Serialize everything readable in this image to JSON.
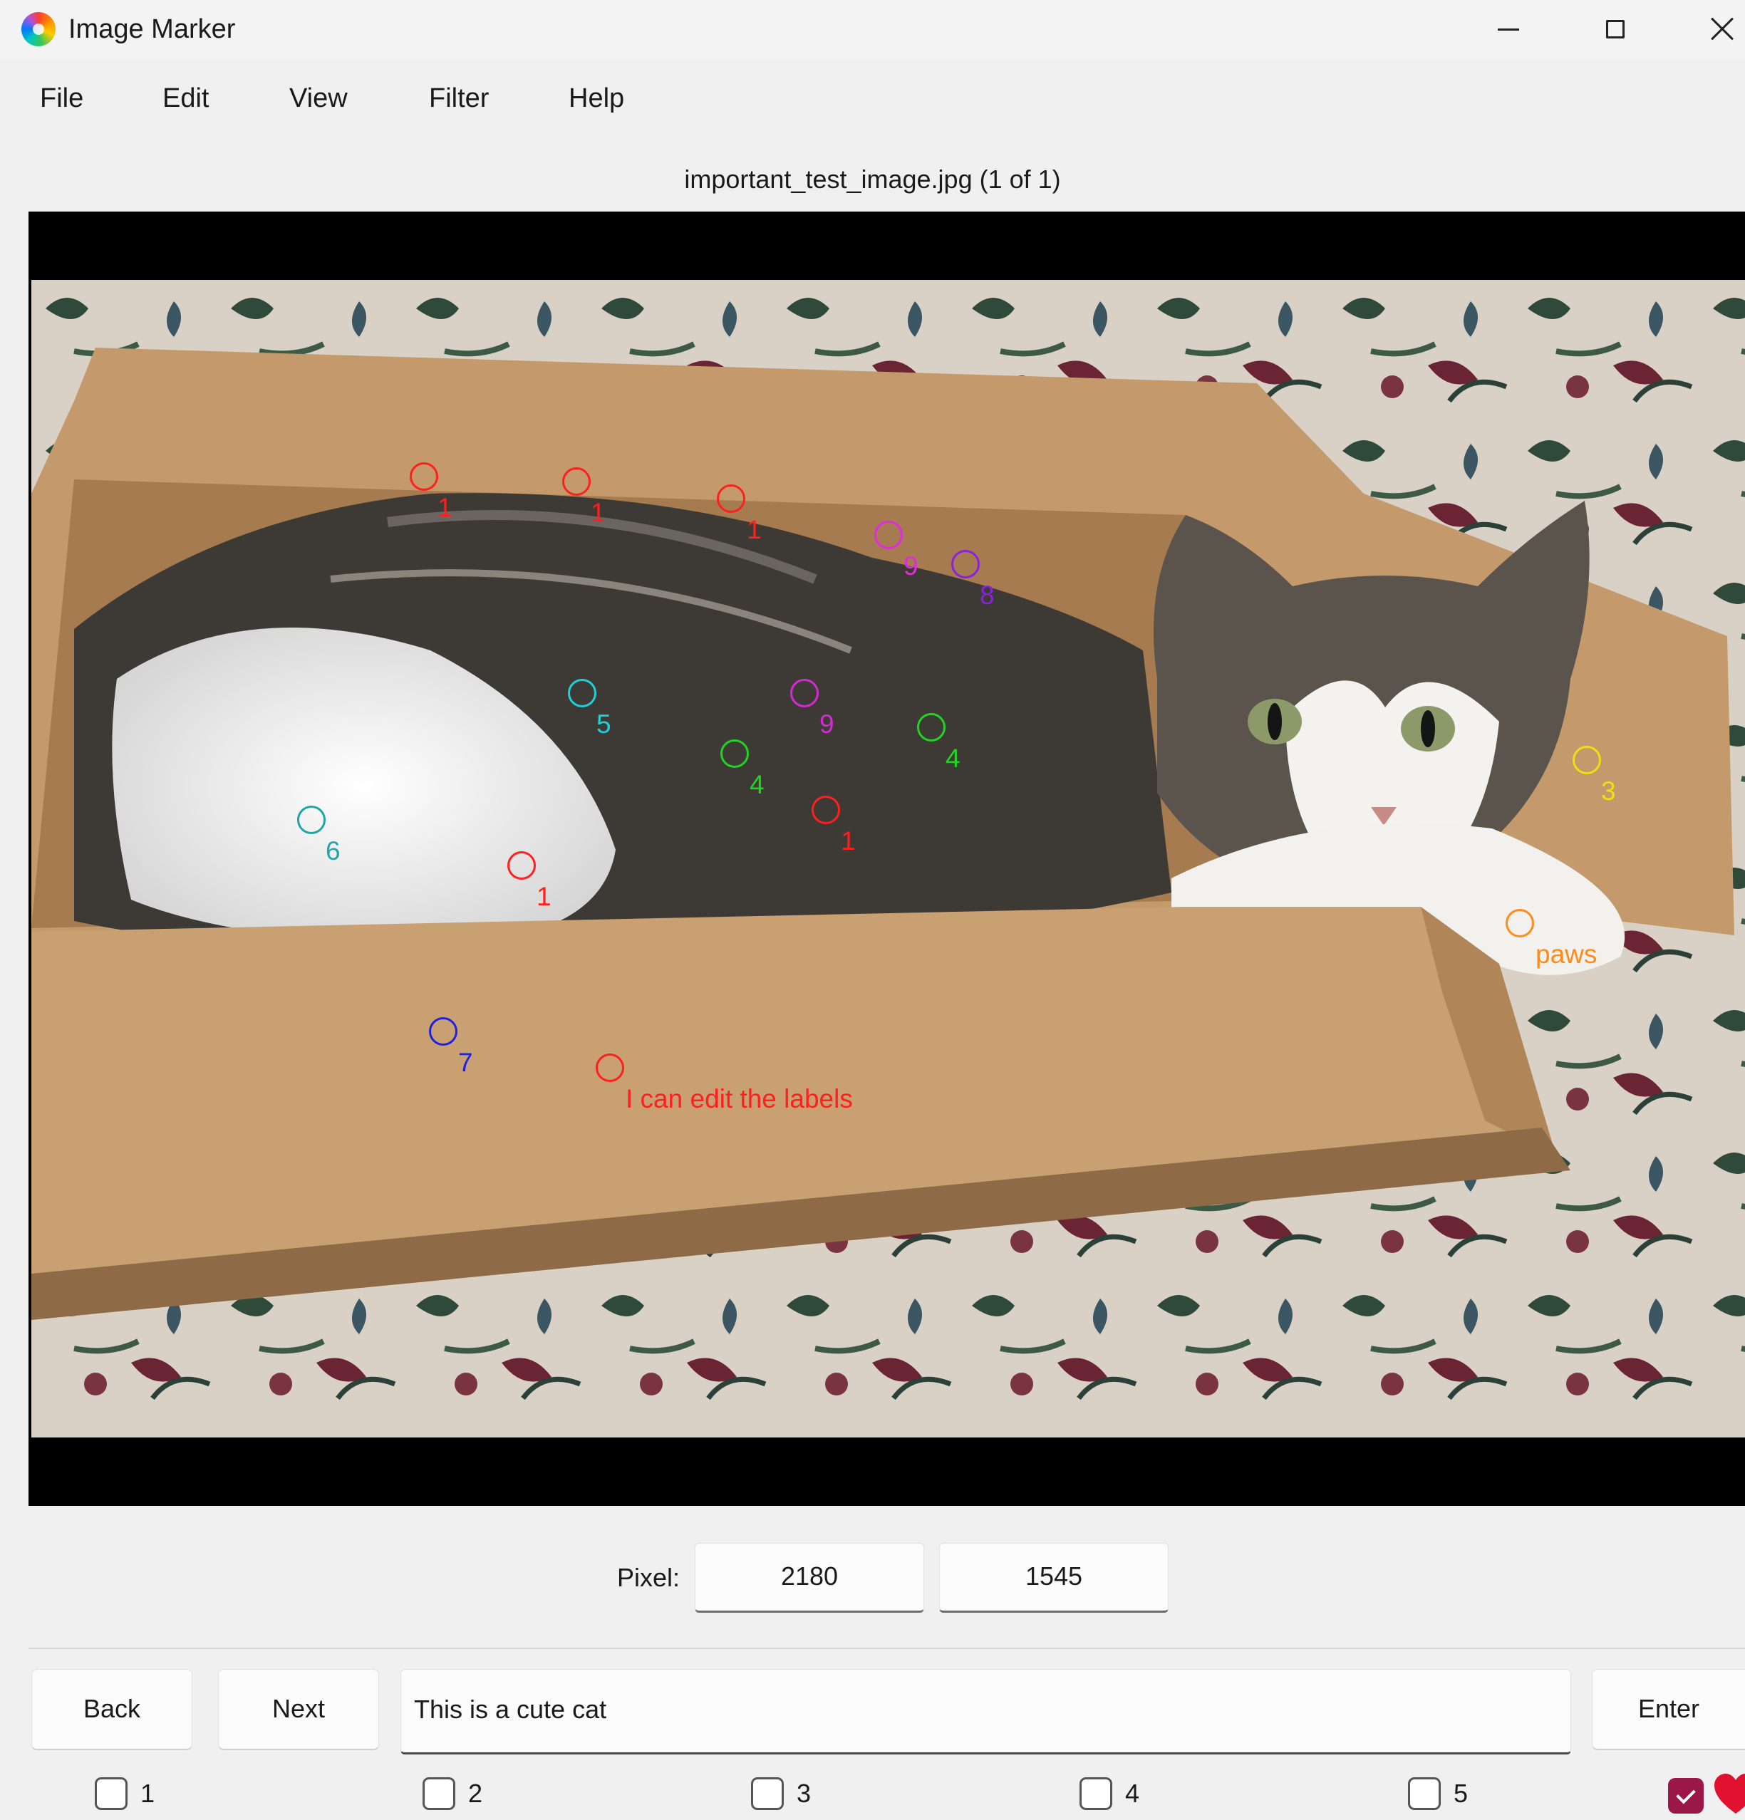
{
  "window": {
    "title": "Image Marker",
    "icons": [
      "app-logo-icon",
      "minimize-icon",
      "maximize-icon",
      "close-icon"
    ]
  },
  "menu": {
    "items": [
      "File",
      "Edit",
      "View",
      "Filter",
      "Help"
    ]
  },
  "viewer": {
    "filename": "important_test_image.jpg (1 of 1)",
    "markers": [
      {
        "label": "1",
        "color": "#ff1f1f"
      },
      {
        "label": "1",
        "color": "#ff1f1f"
      },
      {
        "label": "1",
        "color": "#ff1f1f"
      },
      {
        "label": "9",
        "color": "#e02be0"
      },
      {
        "label": "8",
        "color": "#8a20e0"
      },
      {
        "label": "5",
        "color": "#1fd0d8"
      },
      {
        "label": "9",
        "color": "#d42ad4"
      },
      {
        "label": "4",
        "color": "#22d422"
      },
      {
        "label": "4",
        "color": "#22d422"
      },
      {
        "label": "1",
        "color": "#ff1f1f"
      },
      {
        "label": "6",
        "color": "#1fa7a7"
      },
      {
        "label": "1",
        "color": "#ff1f1f"
      },
      {
        "label": "3",
        "color": "#f0e010"
      },
      {
        "label": "paws",
        "color": "#ff8c1a"
      },
      {
        "label": "7",
        "color": "#2020e0"
      },
      {
        "label": "I can edit the labels",
        "color": "#ff1f1f"
      }
    ]
  },
  "pixel": {
    "label": "Pixel:",
    "x": "2180",
    "y": "1545"
  },
  "controls": {
    "back_label": "Back",
    "next_label": "Next",
    "comment_value": "This is a cute cat",
    "enter_label": "Enter",
    "checkboxes": [
      "1",
      "2",
      "3",
      "4",
      "5"
    ],
    "favorite_checked": true,
    "favorite_color": "#9b1745",
    "heart_color": "#e0102f"
  }
}
